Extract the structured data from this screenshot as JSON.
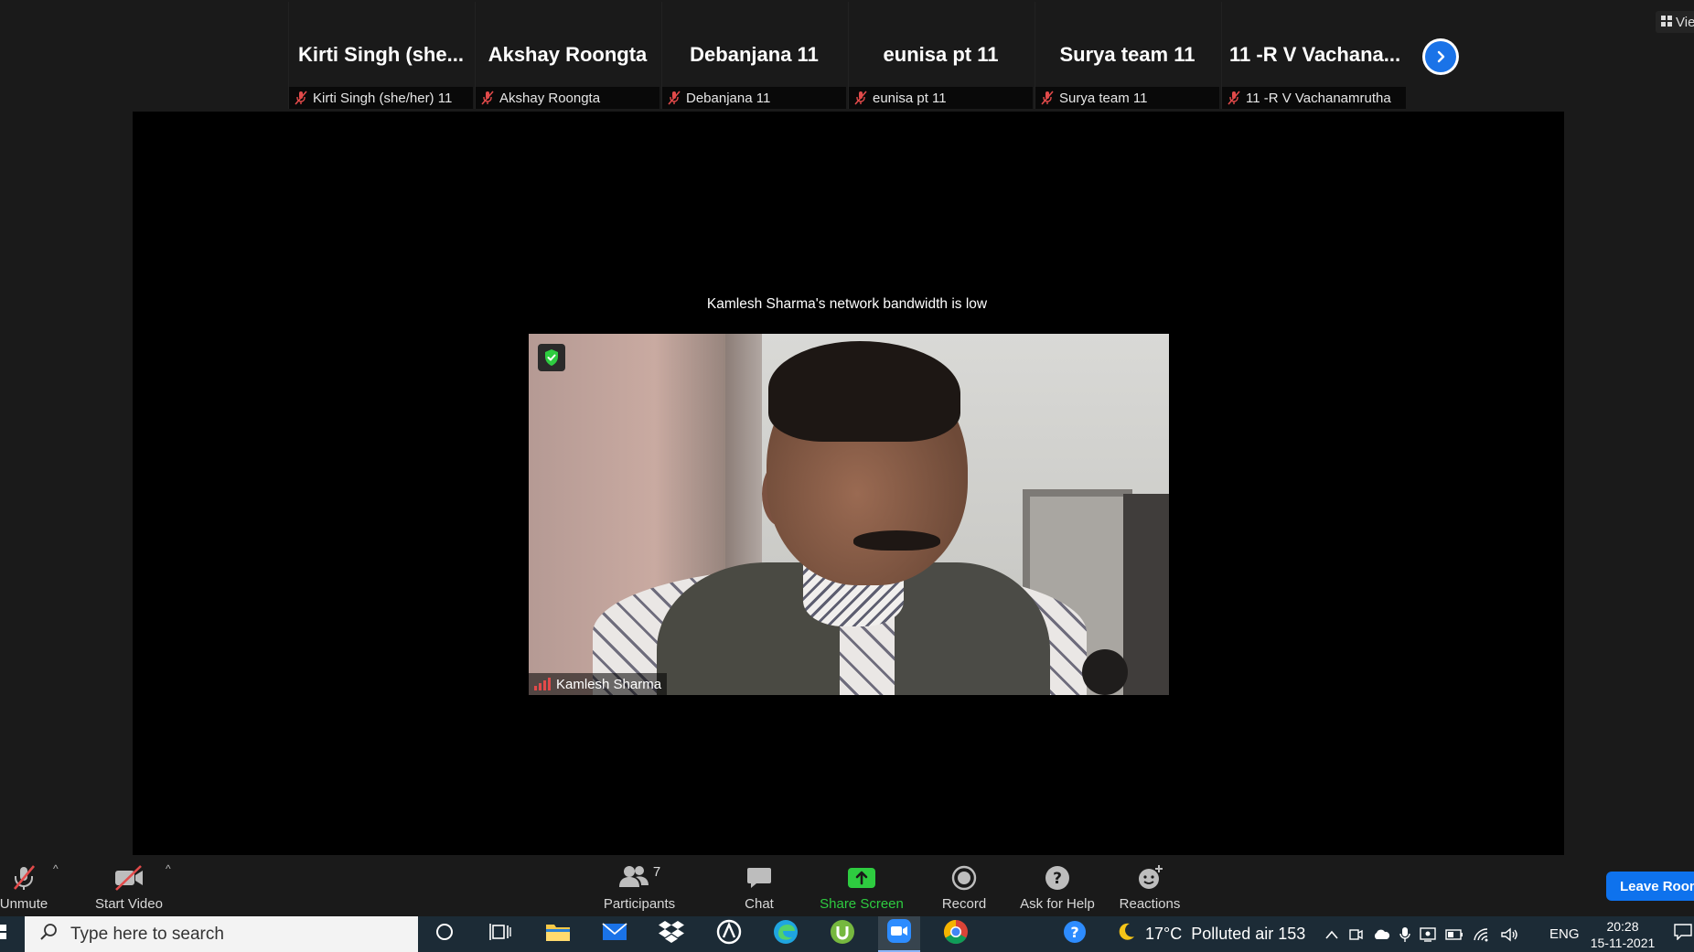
{
  "gallery": {
    "tiles": [
      {
        "display_name": "Kirti Singh  (she...",
        "footer_name": "Kirti Singh (she/her) 11",
        "muted": true
      },
      {
        "display_name": "Akshay Roongta",
        "footer_name": "Akshay Roongta",
        "muted": true
      },
      {
        "display_name": "Debanjana 11",
        "footer_name": "Debanjana 11",
        "muted": true
      },
      {
        "display_name": "eunisa pt 11",
        "footer_name": "eunisa pt 11",
        "muted": true
      },
      {
        "display_name": "Surya team 11",
        "footer_name": "Surya team 11",
        "muted": true
      },
      {
        "display_name": "11 -R V Vachana...",
        "footer_name": "11 -R V Vachanamrutha",
        "muted": true
      }
    ],
    "next_icon": "chevron-right-icon",
    "view_label": "Vie"
  },
  "stage": {
    "notice": "Kamlesh Sharma's network bandwidth is low",
    "speaker_name": "Kamlesh Sharma",
    "shield_icon": "shield-check-icon",
    "signal_color": "#e24a4a"
  },
  "toolbar": {
    "unmute_label": "Unmute",
    "start_video_label": "Start Video",
    "participants_label": "Participants",
    "participants_count": "7",
    "chat_label": "Chat",
    "share_screen_label": "Share Screen",
    "record_label": "Record",
    "ask_help_label": "Ask for Help",
    "reactions_label": "Reactions",
    "leave_label": "Leave Room",
    "share_color": "#2ecc40",
    "leave_color": "#0e72ed"
  },
  "taskbar": {
    "search_placeholder": "Type here to search",
    "weather_temp": "17°C",
    "weather_text": "Polluted air 153",
    "language": "ENG",
    "time": "20:28",
    "date": "15-11-2021"
  }
}
